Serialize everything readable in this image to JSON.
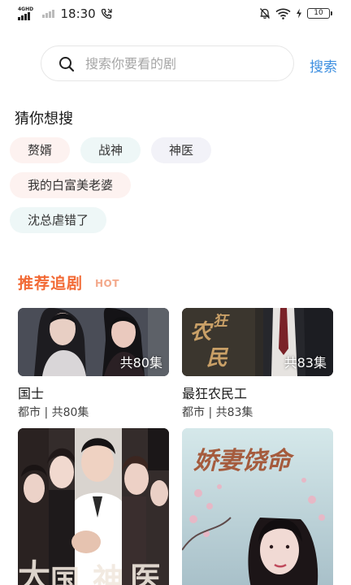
{
  "status_bar": {
    "network": "4GHD",
    "time": "18:30",
    "battery": "10"
  },
  "search": {
    "placeholder": "搜索你要看的剧",
    "button_label": "搜索"
  },
  "guess": {
    "title": "猜你想搜",
    "tags": [
      "赘婿",
      "战神",
      "神医",
      "我的白富美老婆",
      "沈总虐错了"
    ]
  },
  "recommend": {
    "title": "推荐追剧",
    "badge": "HOT",
    "dramas": [
      {
        "title": "国士",
        "meta": "都市 | 共80集",
        "episodes": "共80集"
      },
      {
        "title": "最狂农民工",
        "meta": "都市 | 共83集",
        "episodes": "共83集",
        "poster_text": "农民狂"
      },
      {
        "title": "",
        "meta": "",
        "episodes": "",
        "poster_text": ""
      },
      {
        "title": "",
        "meta": "",
        "episodes": "",
        "poster_text": "娇妻饶命"
      }
    ]
  },
  "colors": {
    "accent_blue": "#3d8fe0",
    "hot_orange": "#f26a35",
    "tag_pink": "#fdf2f0",
    "tag_blue": "#eef7f7",
    "tag_lavender": "#f2f2f8"
  }
}
